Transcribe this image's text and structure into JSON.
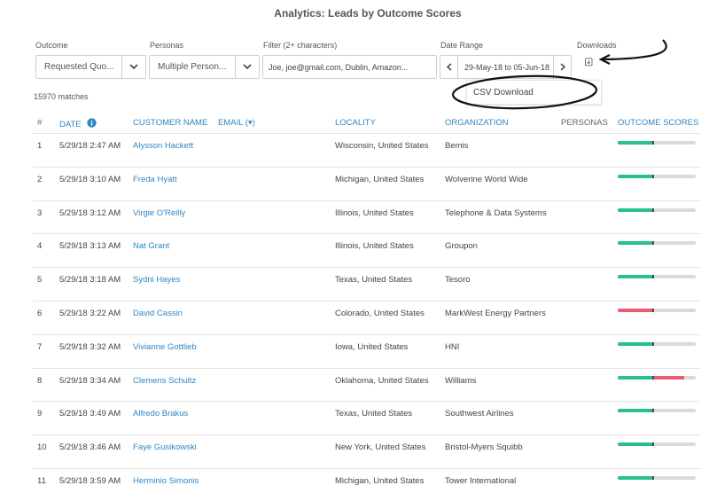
{
  "page_title": "Analytics: Leads by Outcome Scores",
  "filters": {
    "outcome": {
      "label": "Outcome",
      "value": "Requested Quo..."
    },
    "personas": {
      "label": "Personas",
      "value": "Multiple Person..."
    },
    "filter": {
      "label": "Filter (2+ characters)",
      "value": "Joe, joe@gmail.com, Dublin, Amazon..."
    },
    "date_range": {
      "label": "Date Range",
      "value": "29-May-18 to 05-Jun-18"
    },
    "downloads": {
      "label": "Downloads",
      "icon": "download-icon",
      "menu_item": "CSV Download"
    }
  },
  "matches_text": "15970 matches",
  "columns": {
    "num": "#",
    "date": "DATE",
    "customer_name": "CUSTOMER NAME",
    "email": "EMAIL (▾)",
    "locality": "LOCALITY",
    "organization": "ORGANIZATION",
    "personas": "PERSONAS",
    "outcome_scores": "OUTCOME SCORES"
  },
  "colors": {
    "link": "#2f87c4",
    "score_good": "#27c08e",
    "score_bad": "#ee5a6f",
    "track": "#dadada"
  },
  "rows": [
    {
      "num": "1",
      "date": "5/29/18 2:47 AM",
      "name": "Alysson Hackett",
      "locality": "Wisconsin, United States",
      "organization": "Bemis",
      "score": {
        "green": 0.45,
        "red": 0
      }
    },
    {
      "num": "2",
      "date": "5/29/18 3:10 AM",
      "name": "Freda Hyatt",
      "locality": "Michigan, United States",
      "organization": "Wolverine World Wide",
      "score": {
        "green": 0.45,
        "red": 0
      }
    },
    {
      "num": "3",
      "date": "5/29/18 3:12 AM",
      "name": "Virgie O'Reilly",
      "locality": "Illinois, United States",
      "organization": "Telephone & Data Systems",
      "score": {
        "green": 0.45,
        "red": 0
      }
    },
    {
      "num": "4",
      "date": "5/29/18 3:13 AM",
      "name": "Nat Grant",
      "locality": "Illinois, United States",
      "organization": "Groupon",
      "score": {
        "green": 0.45,
        "red": 0
      }
    },
    {
      "num": "5",
      "date": "5/29/18 3:18 AM",
      "name": "Sydni Hayes",
      "locality": "Texas, United States",
      "organization": "Tesoro",
      "score": {
        "green": 0.45,
        "red": 0
      }
    },
    {
      "num": "6",
      "date": "5/29/18 3:22 AM",
      "name": "David Cassin",
      "locality": "Colorado, United States",
      "organization": "MarkWest Energy Partners",
      "score": {
        "green": 0,
        "red": 0.45
      }
    },
    {
      "num": "7",
      "date": "5/29/18 3:32 AM",
      "name": "Vivianne Gottlieb",
      "locality": "Iowa, United States",
      "organization": "HNI",
      "score": {
        "green": 0.45,
        "red": 0
      }
    },
    {
      "num": "8",
      "date": "5/29/18 3:34 AM",
      "name": "Clemens Schultz",
      "locality": "Oklahoma, United States",
      "organization": "Williams",
      "score": {
        "green": 0.45,
        "red": 0.4
      }
    },
    {
      "num": "9",
      "date": "5/29/18 3:49 AM",
      "name": "Alfredo Brakus",
      "locality": "Texas, United States",
      "organization": "Southwest Airlines",
      "score": {
        "green": 0.45,
        "red": 0
      }
    },
    {
      "num": "10",
      "date": "5/29/18 3:46 AM",
      "name": "Faye Gusikowski",
      "locality": "New York, United States",
      "organization": "Bristol-Myers Squibb",
      "score": {
        "green": 0.45,
        "red": 0
      }
    },
    {
      "num": "11",
      "date": "5/29/18 3:59 AM",
      "name": "Herminio Simonis",
      "locality": "Michigan, United States",
      "organization": "Tower International",
      "score": {
        "green": 0.45,
        "red": 0
      }
    }
  ]
}
